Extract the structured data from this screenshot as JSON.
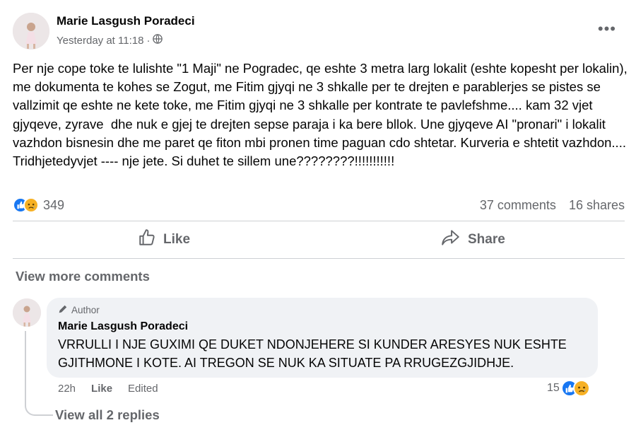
{
  "post": {
    "author": "Marie Lasgush Poradeci",
    "timestamp": "Yesterday at 11:18",
    "privacy_separator": "·",
    "privacy_icon": "globe-icon",
    "more_icon": "more-dots-icon",
    "more_label": "•••",
    "text": "Per nje cope toke te lulishte \"1 Maji\" ne Pogradec, qe eshte 3 metra larg lokalit (eshte kopesht per lokalin), me dokumenta te kohes se Zogut, me Fitim gjyqi ne 3 shkalle per te drejten e parablerjes se pistes se vallzimit qe eshte ne kete toke, me Fitim gjyqi ne 3 shkalle per kontrate te pavlefshme.... kam 32 vjet gjyqeve, zyrave  dhe nuk e gjej te drejten sepse paraja i ka bere bllok. Une gjyqeve AI \"pronari\" i lokalit vazhdon bisnesin dhe me paret qe fiton mbi pronen time paguan cdo shtetar. Kurveria e shtetit vazhdon.... Tridhjetedyvjet ---- nje jete. Si duhet te sillem une????????!!!!!!!!!!!",
    "reaction_count": "349",
    "comments": "37 comments",
    "shares": "16 shares"
  },
  "actions": {
    "like": "Like",
    "share": "Share"
  },
  "comments_section": {
    "view_more": "View more comments",
    "comment": {
      "badge": "Author",
      "author": "Marie Lasgush Poradeci",
      "text": "VRRULLI I NJE GUXIMI QE DUKET NDONJEHERE SI KUNDER ARESYES NUK ESHTE GJITHMONE I KOTE. AI TREGON SE NUK KA SITUATE PA RRUGEZGJIDHJE.",
      "age": "22h",
      "like": "Like",
      "edited": "Edited",
      "reaction_count": "15"
    },
    "view_replies": "View all 2 replies"
  },
  "colors": {
    "like_blue": "#1877f2",
    "sad_yellow": "#f7b125",
    "secondary_text": "#65676b",
    "bubble_bg": "#f0f2f5"
  }
}
